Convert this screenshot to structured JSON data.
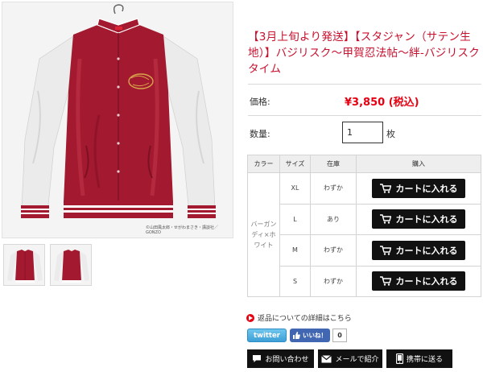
{
  "product": {
    "title": "【3月上旬より発送】【スタジャン（サテン生地）】バジリスク～甲賀忍法帖～絆-バジリスクタイム",
    "image_copyright": "©山田風太郎・せがわまさき・講談社／GONZO",
    "price_label": "価格:",
    "price_value": "¥3,850 (税込)",
    "quantity_label": "数量:",
    "quantity_value": "1",
    "quantity_unit": "枚"
  },
  "stock_table": {
    "headers": [
      "カラー",
      "サイズ",
      "在庫",
      "購入"
    ],
    "color": "バーガンディ×ホワイト",
    "rows": [
      {
        "size": "XL",
        "stock": "わずか",
        "button": "カートに入れる"
      },
      {
        "size": "L",
        "stock": "あり",
        "button": "カートに入れる"
      },
      {
        "size": "M",
        "stock": "わずか",
        "button": "カートに入れる"
      },
      {
        "size": "S",
        "stock": "わずか",
        "button": "カートに入れる"
      }
    ]
  },
  "links": {
    "returns": "返品についての詳細はこちら"
  },
  "social": {
    "twitter": "twitter",
    "like": "いいね！",
    "like_count": "0"
  },
  "actions": {
    "inquiry": "お問い合わせ",
    "mail": "メールで紹介",
    "mobile": "携帯に送る"
  },
  "colors": {
    "accent_red": "#e60012",
    "title_red": "#c8102e",
    "jacket_burgundy": "#a3192f",
    "jacket_white": "#f0eeee",
    "button_black": "#111111"
  }
}
